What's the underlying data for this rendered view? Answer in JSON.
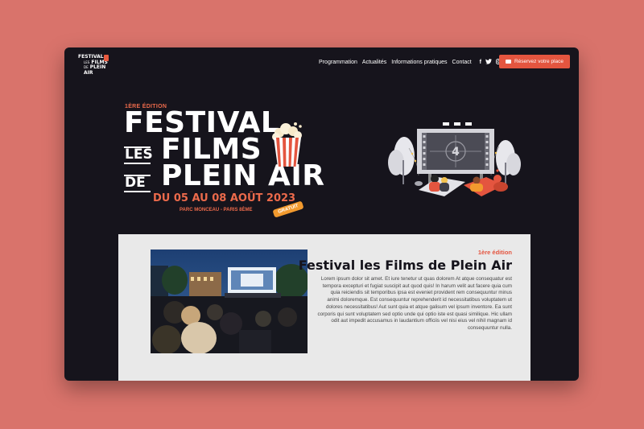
{
  "logo": {
    "line1": "FESTIVAL",
    "line2": "FILMS",
    "line3": "PLEIN AIR",
    "mini1": "LES",
    "mini2": "DE"
  },
  "nav": {
    "items": [
      "Programmation",
      "Actualités",
      "Informations pratiques",
      "Contact"
    ],
    "social_icons": [
      "facebook-icon",
      "twitter-icon",
      "instagram-icon"
    ],
    "cta_label": "Réservez votre place"
  },
  "hero": {
    "edition": "1ÈRE ÉDITION",
    "line1": "FESTIVAL",
    "word_les": "LES",
    "line2": "FILMS",
    "word_de": "DE",
    "line3": "PLEIN AIR",
    "dates": "DU 05 AU 08 AOÛT 2023",
    "place": "PARC MONCEAU - PARIS 8ÈME",
    "badge": "GRATUIT",
    "countdown": "4"
  },
  "content": {
    "tag": "1ère édition",
    "title": "Festival les Films de Plein Air",
    "text": "Lorem ipsum dolor sit amet. Et iure tenetur ut quas dolorem At atque consequatur est tempora excepturi et fugiat suscipit aut quod quis! In harum velit aut facere quia cum quia reiciendis sit temporibus ipsa est eveniet provident rem consequuntur minus animi doloremque. Est consequuntur reprehenderit id necessitatibus voluptatem ut dolores necessitatibus! Aut sunt quia et atque galisum vel ipsum inventore. Ea sunt corporis qui sunt voluptatem sed optio unde qui optio iste est quasi similique. Hic ullam odit aut impedit accusamus in laudantium officiis vel nisi eius vel nihil magnam id consequuntur nulla."
  },
  "colors": {
    "accent": "#e4553f",
    "background": "#16141c",
    "page_bg": "#d9736b",
    "badge": "#f29a2e"
  }
}
